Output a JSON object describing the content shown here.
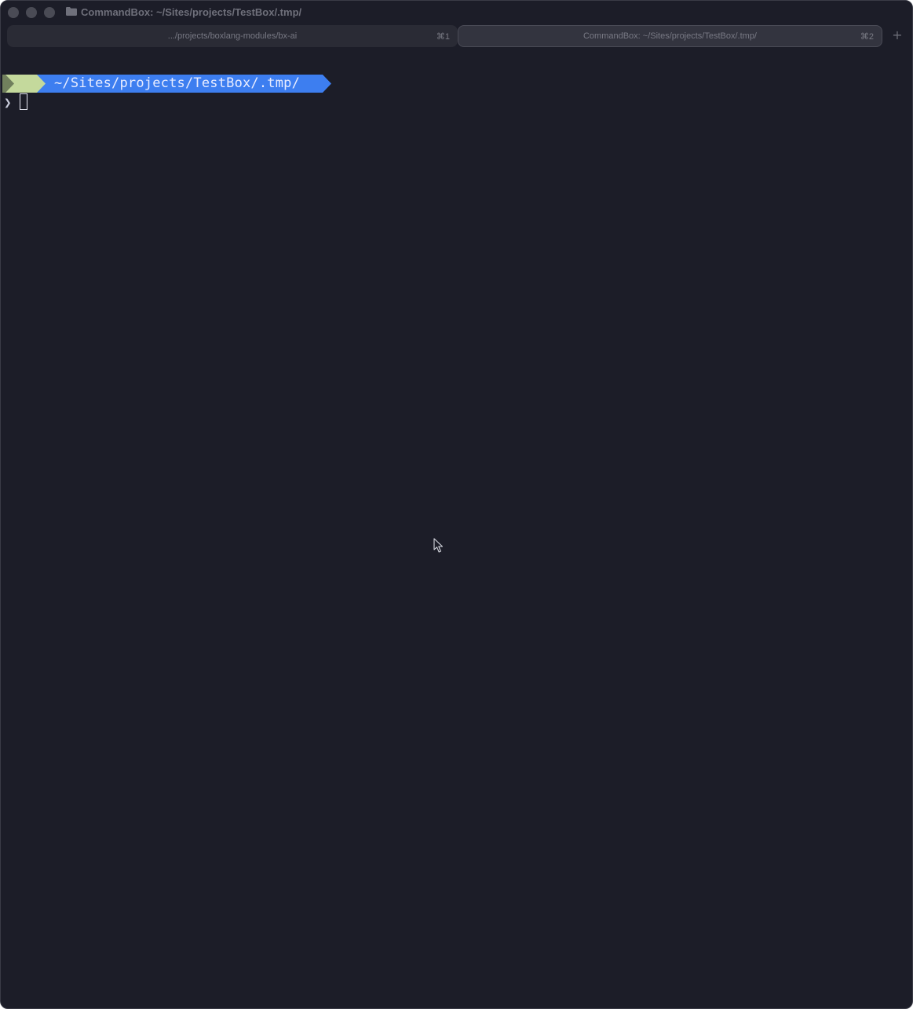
{
  "window": {
    "title": "CommandBox: ~/Sites/projects/TestBox/.tmp/",
    "title_icon": "folder-icon",
    "background_color": "#1c1d28"
  },
  "tabs": [
    {
      "label": ".../projects/boxlang-modules/bx-ai",
      "shortcut": "⌘1",
      "active": false
    },
    {
      "label": "CommandBox: ~/Sites/projects/TestBox/.tmp/",
      "shortcut": "⌘2",
      "active": true
    }
  ],
  "new_tab": {
    "label": "+"
  },
  "terminal": {
    "prompt_path": "~/Sites/projects/TestBox/.tmp/",
    "prompt_char": "❯",
    "input": "",
    "colors": {
      "segment_green": "#c4d99c",
      "segment_blue": "#3d7ef0",
      "text": "#e8ecff"
    }
  }
}
